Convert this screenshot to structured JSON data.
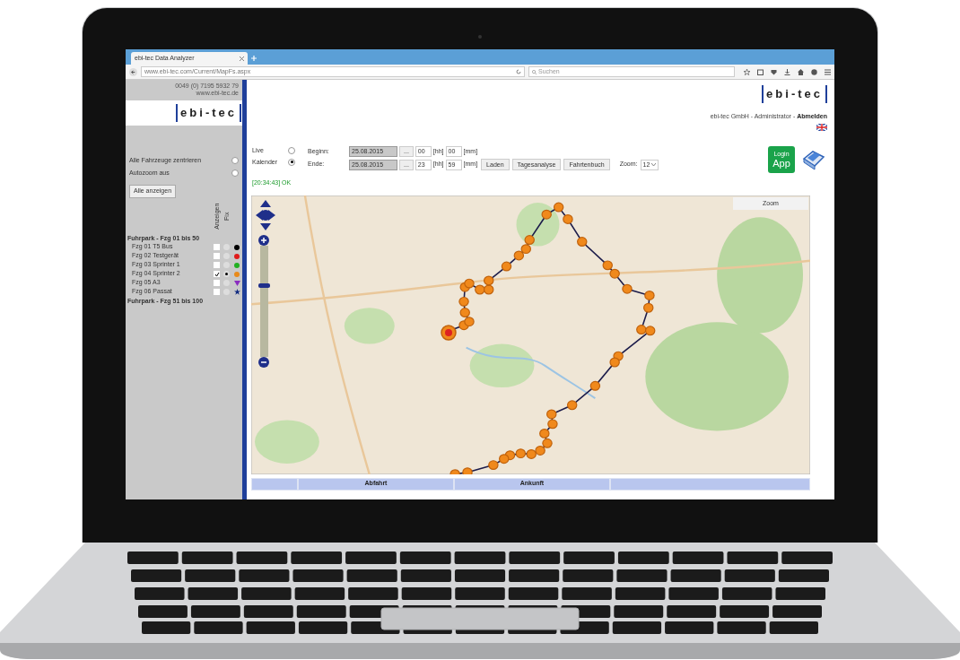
{
  "browser": {
    "tab_title": "ebi-tec Data Analyzer",
    "url": "www.ebi-tec.com/Current/MapFs.aspx",
    "search_placeholder": "Suchen"
  },
  "sidebar": {
    "contact": [
      "0049 (0) 7195 5932 79",
      "www.ebi-tec.de"
    ],
    "logo": "ebi-tec",
    "options": [
      {
        "label": "Alle Fahrzeuge zentrieren",
        "selected": false
      },
      {
        "label": "Autozoom aus",
        "selected": false
      }
    ],
    "show_all_button": "Alle anzeigen",
    "column_headers": [
      "Anzeigen",
      "Fix"
    ],
    "groups": [
      {
        "title": "Fuhrpark - Fzg 01 bis 50",
        "vehicles": [
          {
            "name": "Fzg 01 T5 Bus",
            "checked": false,
            "selected": false,
            "color": "#000000",
            "kind": "dot"
          },
          {
            "name": "Fzg 02 Testgerät",
            "checked": false,
            "selected": false,
            "color": "#e01b1b",
            "kind": "dot"
          },
          {
            "name": "Fzg 03 Sprinter 1",
            "checked": false,
            "selected": false,
            "color": "#22b022",
            "kind": "dot"
          },
          {
            "name": "Fzg 04 Sprinter 2",
            "checked": true,
            "selected": true,
            "color": "#e88a1a",
            "kind": "dot"
          },
          {
            "name": "Fzg 05 A3",
            "checked": false,
            "selected": false,
            "color": "#8a2cc0",
            "kind": "triangle"
          },
          {
            "name": "Fzg 06 Passat",
            "checked": false,
            "selected": false,
            "color": "#102a80",
            "kind": "star"
          }
        ]
      },
      {
        "title": "Fuhrpark - Fzg 51 bis 100"
      }
    ]
  },
  "header": {
    "logo": "ebi-tec",
    "company": "ebi-tec GmbH - Administrator - ",
    "logout_link": "Abmelden"
  },
  "controls": {
    "modes": [
      {
        "label": "Live",
        "selected": false
      },
      {
        "label": "Kalender",
        "selected": true
      }
    ],
    "rows": [
      {
        "label": "Beginn:",
        "date": "25.08.2015",
        "picker": "...",
        "hour": "00",
        "hour_unit": "[hh]",
        "minute": "00",
        "minute_unit": "[mm]"
      },
      {
        "label": "Ende:",
        "date": "25.08.2015",
        "picker": "...",
        "hour": "23",
        "hour_unit": "[hh]",
        "minute": "59",
        "minute_unit": "[mm]"
      }
    ],
    "buttons": [
      "Laden",
      "Tagesanalyse",
      "Fahrtenbuch"
    ],
    "zoom_label": "Zoom:",
    "zoom_value": "12",
    "app_badge": {
      "top": "Login",
      "main": "App"
    }
  },
  "status": "[20:34:43] OK",
  "map": {
    "zoom_button": "Zoom",
    "zoom_slider": {
      "level": 0.63
    }
  },
  "table": {
    "columns": [
      "Abfahrt",
      "Ankunft"
    ]
  }
}
